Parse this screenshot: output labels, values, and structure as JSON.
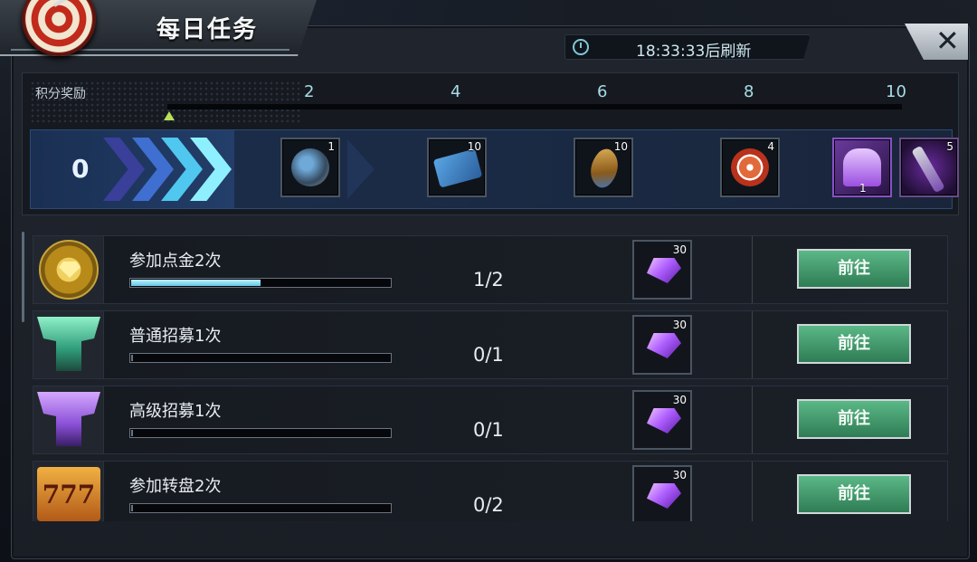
{
  "header": {
    "title": "每日任务",
    "timer_text": "18:33:33后刷新",
    "close_label": "✕"
  },
  "rewards": {
    "label": "积分奖励",
    "current_points": "0",
    "progress_fraction": 0.0,
    "milestones": [
      "2",
      "4",
      "6",
      "8",
      "10"
    ],
    "items": [
      {
        "icon": "coin-icon",
        "qty": "1"
      },
      {
        "icon": "ticket-icon",
        "qty": "10"
      },
      {
        "icon": "bullet-icon",
        "qty": "10"
      },
      {
        "icon": "chip-icon",
        "qty": "4"
      },
      {
        "icon": "purple-avatar-icon",
        "qty": "1"
      },
      {
        "icon": "hammer-icon",
        "qty": "5"
      }
    ]
  },
  "tasks": [
    {
      "name": "参加点金2次",
      "count": "1/2",
      "progress": 0.5,
      "reward_qty": "30",
      "button": "前往",
      "icon": "gold-diamond-icon"
    },
    {
      "name": "普通招募1次",
      "count": "0/1",
      "progress": 0.0,
      "reward_qty": "30",
      "button": "前往",
      "icon": "green-recruit-icon"
    },
    {
      "name": "高级招募1次",
      "count": "0/1",
      "progress": 0.0,
      "reward_qty": "30",
      "button": "前往",
      "icon": "purple-recruit-icon"
    },
    {
      "name": "参加转盘2次",
      "count": "0/2",
      "progress": 0.0,
      "reward_qty": "30",
      "button": "前往",
      "icon": "slot-777-icon"
    }
  ],
  "slot_icon_text": "777"
}
